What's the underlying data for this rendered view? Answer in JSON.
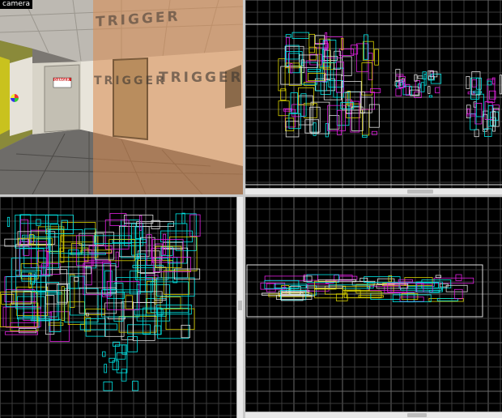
{
  "viewports": {
    "camera": {
      "label": "camera",
      "trigger_text": "TRIGGER",
      "door_sign_text": "DANGER"
    },
    "top": {
      "label": ""
    },
    "front": {
      "label": ""
    },
    "side": {
      "label": ""
    }
  },
  "colors": {
    "grid_minor": "#3a3a3a",
    "grid_major": "#6a6a6a",
    "brush_cyan": "#00e8e8",
    "brush_magenta": "#e020e0",
    "brush_yellow": "#d8d000",
    "brush_white": "#e0e0e0",
    "trigger_overlay": "#d98a4e"
  }
}
